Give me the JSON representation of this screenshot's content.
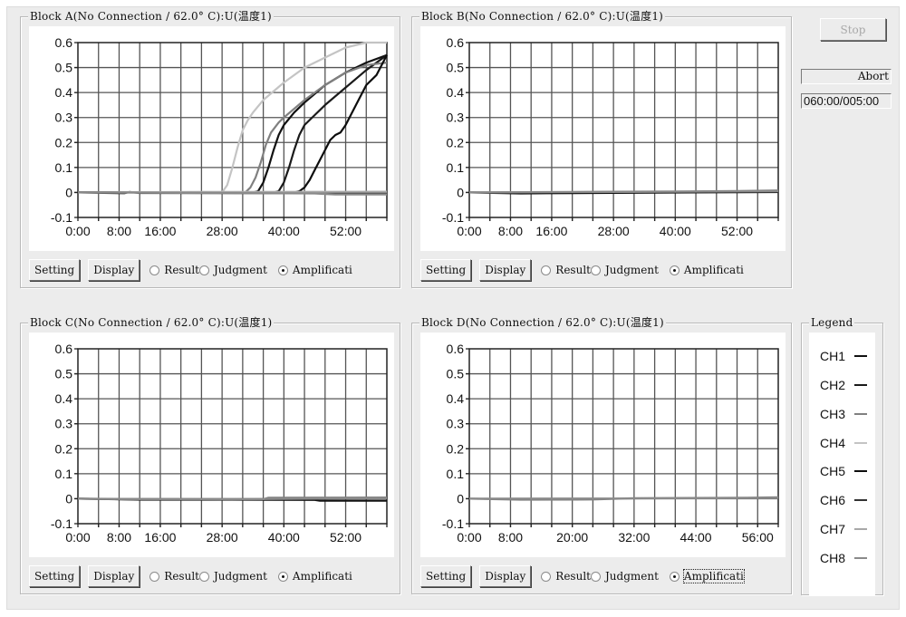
{
  "controls": {
    "stop_label": "Stop",
    "status_text": "Abort",
    "time_text": "060:00/005:00"
  },
  "blocks": [
    {
      "title": "Block A(No Connection / 62.0° C):U(温度1)",
      "buttons": {
        "setting": "Setting",
        "display": "Display"
      },
      "radios": [
        {
          "label": "Result",
          "selected": false
        },
        {
          "label": "Judgment",
          "selected": false
        },
        {
          "label": "Amplificati",
          "selected": true
        }
      ],
      "focused_radio": false
    },
    {
      "title": "Block B(No Connection / 62.0° C):U(温度1)",
      "buttons": {
        "setting": "Setting",
        "display": "Display"
      },
      "radios": [
        {
          "label": "Result",
          "selected": false
        },
        {
          "label": "Judgment",
          "selected": false
        },
        {
          "label": "Amplificati",
          "selected": true
        }
      ],
      "focused_radio": false
    },
    {
      "title": "Block C(No Connection / 62.0° C):U(温度1)",
      "buttons": {
        "setting": "Setting",
        "display": "Display"
      },
      "radios": [
        {
          "label": "Result",
          "selected": false
        },
        {
          "label": "Judgment",
          "selected": false
        },
        {
          "label": "Amplificati",
          "selected": true
        }
      ],
      "focused_radio": false
    },
    {
      "title": "Block D(No Connection / 62.0° C):U(温度1)",
      "buttons": {
        "setting": "Setting",
        "display": "Display"
      },
      "radios": [
        {
          "label": "Result",
          "selected": false
        },
        {
          "label": "Judgment",
          "selected": false
        },
        {
          "label": "Amplificati",
          "selected": true
        }
      ],
      "focused_radio": true
    }
  ],
  "legend": {
    "title": "Legend",
    "items": [
      {
        "label": "CH1",
        "color": "#111111"
      },
      {
        "label": "CH2",
        "color": "#1a1a1a"
      },
      {
        "label": "CH3",
        "color": "#808080"
      },
      {
        "label": "CH4",
        "color": "#c4c4c4"
      },
      {
        "label": "CH5",
        "color": "#0d0d0d"
      },
      {
        "label": "CH6",
        "color": "#333333"
      },
      {
        "label": "CH7",
        "color": "#a8a8a8"
      },
      {
        "label": "CH8",
        "color": "#8a8a8a"
      }
    ]
  },
  "chart_data": [
    {
      "type": "line",
      "title": "Block A(No Connection / 62.0° C):U(温度1)",
      "xlabel": "",
      "ylabel": "",
      "xlim": [
        0,
        60
      ],
      "ylim": [
        -0.1,
        0.6
      ],
      "x_unit": "minutes",
      "x_ticks": [
        0,
        8,
        16,
        28,
        40,
        52
      ],
      "x_tick_labels": [
        "0:00",
        "8:00",
        "16:00",
        "28:00",
        "40:00",
        "52:00"
      ],
      "y_ticks": [
        -0.1,
        0,
        0.1,
        0.2,
        0.3,
        0.4,
        0.5,
        0.6
      ],
      "y_tick_labels": [
        "-0.1",
        "0",
        "0.1",
        "0.2",
        "0.3",
        "0.4",
        "0.5",
        "0.6"
      ],
      "grid": true,
      "series": [
        {
          "name": "CH1",
          "x": [
            0,
            34,
            35,
            36,
            37,
            38,
            39,
            40,
            42,
            44,
            48,
            52,
            56,
            60
          ],
          "y": [
            0,
            0,
            0.005,
            0.04,
            0.1,
            0.17,
            0.23,
            0.27,
            0.32,
            0.36,
            0.43,
            0.48,
            0.52,
            0.55
          ]
        },
        {
          "name": "CH2",
          "x": [
            0,
            38,
            39,
            40,
            41,
            42,
            43,
            44,
            46,
            48,
            52,
            56,
            60
          ],
          "y": [
            0,
            0,
            0.005,
            0.04,
            0.1,
            0.17,
            0.23,
            0.27,
            0.31,
            0.35,
            0.42,
            0.49,
            0.55
          ]
        },
        {
          "name": "CH3",
          "x": [
            0,
            32.5,
            33.5,
            34.5,
            35.5,
            36.5,
            37.5,
            39,
            40,
            44,
            48,
            52,
            56,
            60
          ],
          "y": [
            0,
            0,
            0.02,
            0.06,
            0.12,
            0.19,
            0.24,
            0.28,
            0.3,
            0.37,
            0.43,
            0.48,
            0.51,
            0.52
          ]
        },
        {
          "name": "CH4",
          "x": [
            0,
            28,
            29,
            30,
            31,
            32,
            33,
            34,
            36,
            40,
            44,
            48,
            52,
            56,
            60
          ],
          "y": [
            0,
            0,
            0.03,
            0.1,
            0.18,
            0.25,
            0.29,
            0.32,
            0.37,
            0.44,
            0.5,
            0.54,
            0.58,
            0.6,
            0.6
          ]
        },
        {
          "name": "CH5",
          "x": [
            0,
            42,
            43,
            44,
            45,
            46,
            47,
            48,
            49,
            50,
            51,
            52,
            54,
            56,
            58,
            60
          ],
          "y": [
            0,
            0,
            0.005,
            0.02,
            0.05,
            0.09,
            0.13,
            0.17,
            0.21,
            0.23,
            0.24,
            0.27,
            0.35,
            0.43,
            0.47,
            0.55
          ]
        },
        {
          "name": "CH6",
          "x": [
            0,
            9,
            10,
            12,
            60
          ],
          "y": [
            0,
            -0.003,
            0.002,
            -0.002,
            -0.004
          ]
        },
        {
          "name": "CH7",
          "x": [
            0,
            24,
            30,
            60
          ],
          "y": [
            0,
            0.002,
            0.002,
            0.003
          ]
        },
        {
          "name": "CH8",
          "x": [
            0,
            46,
            48,
            50,
            60
          ],
          "y": [
            0,
            -0.004,
            -0.006,
            -0.008,
            -0.008
          ]
        }
      ]
    },
    {
      "type": "line",
      "title": "Block B(No Connection / 62.0° C):U(温度1)",
      "xlabel": "",
      "ylabel": "",
      "xlim": [
        0,
        60
      ],
      "ylim": [
        -0.1,
        0.6
      ],
      "x_unit": "minutes",
      "x_ticks": [
        0,
        8,
        16,
        28,
        40,
        52
      ],
      "x_tick_labels": [
        "0:00",
        "8:00",
        "16:00",
        "28:00",
        "40:00",
        "52:00"
      ],
      "y_ticks": [
        -0.1,
        0,
        0.1,
        0.2,
        0.3,
        0.4,
        0.5,
        0.6
      ],
      "y_tick_labels": [
        "-0.1",
        "0",
        "0.1",
        "0.2",
        "0.3",
        "0.4",
        "0.5",
        "0.6"
      ],
      "grid": true,
      "series": [
        {
          "name": "CH1",
          "x": [
            0,
            10,
            15,
            60
          ],
          "y": [
            0,
            -0.004,
            -0.003,
            0.002
          ]
        },
        {
          "name": "CH3",
          "x": [
            0,
            28,
            40,
            52,
            60
          ],
          "y": [
            0,
            0.003,
            0.004,
            0.006,
            0.008
          ]
        },
        {
          "name": "CH8",
          "x": [
            0,
            30,
            60
          ],
          "y": [
            0,
            0.002,
            0.005
          ]
        }
      ]
    },
    {
      "type": "line",
      "title": "Block C(No Connection / 62.0° C):U(温度1)",
      "xlabel": "",
      "ylabel": "",
      "xlim": [
        0,
        60
      ],
      "ylim": [
        -0.1,
        0.6
      ],
      "x_unit": "minutes",
      "x_ticks": [
        0,
        8,
        16,
        28,
        40,
        52
      ],
      "x_tick_labels": [
        "0:00",
        "8:00",
        "16:00",
        "28:00",
        "40:00",
        "52:00"
      ],
      "y_ticks": [
        -0.1,
        0,
        0.1,
        0.2,
        0.3,
        0.4,
        0.5,
        0.6
      ],
      "y_tick_labels": [
        "-0.1",
        "0",
        "0.1",
        "0.2",
        "0.3",
        "0.4",
        "0.5",
        "0.6"
      ],
      "grid": true,
      "series": [
        {
          "name": "CH1",
          "x": [
            0,
            12,
            30,
            46,
            47,
            60
          ],
          "y": [
            0,
            -0.004,
            -0.004,
            -0.005,
            -0.008,
            -0.008
          ]
        },
        {
          "name": "CH3",
          "x": [
            0,
            10,
            36,
            37,
            60
          ],
          "y": [
            0,
            -0.002,
            -0.002,
            0.004,
            0.005
          ]
        },
        {
          "name": "CH8",
          "x": [
            0,
            30,
            60
          ],
          "y": [
            0,
            -0.002,
            0.002
          ]
        }
      ]
    },
    {
      "type": "line",
      "title": "Block D(No Connection / 62.0° C):U(温度1)",
      "xlabel": "",
      "ylabel": "",
      "xlim": [
        0,
        60
      ],
      "ylim": [
        -0.1,
        0.6
      ],
      "x_unit": "minutes",
      "x_ticks": [
        0,
        8,
        20,
        32,
        44,
        56
      ],
      "x_tick_labels": [
        "0:00",
        "8:00",
        "20:00",
        "32:00",
        "44:00",
        "56:00"
      ],
      "y_ticks": [
        -0.1,
        0,
        0.1,
        0.2,
        0.3,
        0.4,
        0.5,
        0.6
      ],
      "y_tick_labels": [
        "-0.1",
        "0",
        "0.1",
        "0.2",
        "0.3",
        "0.4",
        "0.5",
        "0.6"
      ],
      "grid": true,
      "series": [
        {
          "name": "CH3",
          "x": [
            0,
            10,
            24,
            32,
            54,
            60
          ],
          "y": [
            0,
            -0.004,
            -0.003,
            0.002,
            0.004,
            0.006
          ]
        },
        {
          "name": "CH8",
          "x": [
            0,
            30,
            60
          ],
          "y": [
            0,
            0.001,
            0.003
          ]
        }
      ]
    }
  ]
}
